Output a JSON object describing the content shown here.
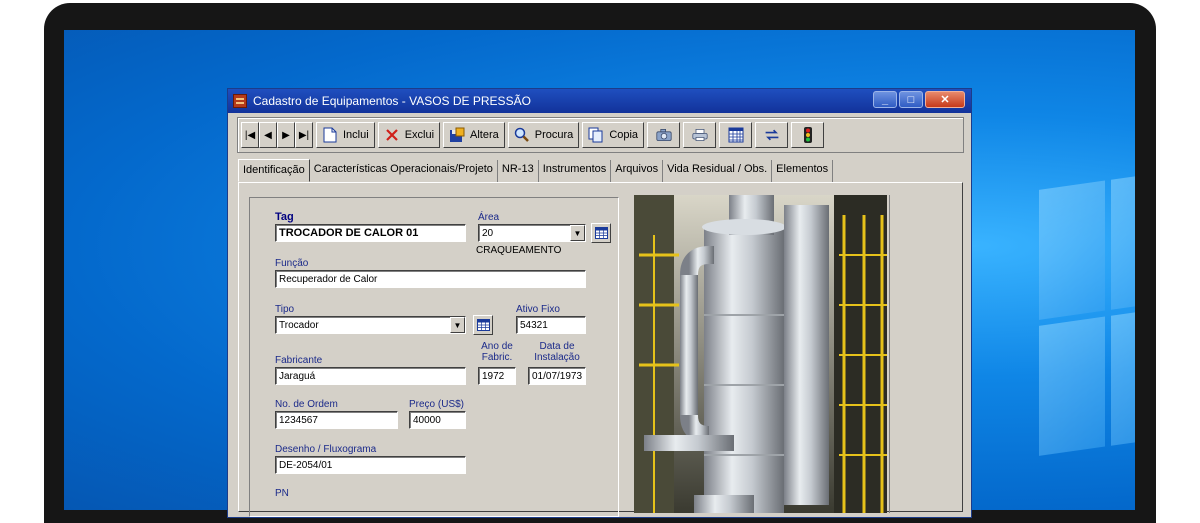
{
  "window": {
    "title": "Cadastro de Equipamentos - VASOS DE PRESSÃO",
    "minimize": "_",
    "maximize": "□",
    "close": "✕"
  },
  "toolbar": {
    "nav": {
      "first": "|◀",
      "prev": "◀",
      "next": "▶",
      "last": "▶|"
    },
    "inclui": "Inclui",
    "exclui": "Exclui",
    "altera": "Altera",
    "procura": "Procura",
    "copia": "Copia"
  },
  "tabs": [
    "Identificação",
    "Características Operacionais/Projeto",
    "NR-13",
    "Instrumentos",
    "Arquivos",
    "Vida Residual / Obs.",
    "Elementos"
  ],
  "form": {
    "tag_label": "Tag",
    "tag_value": "TROCADOR DE CALOR 01",
    "area_label": "Área",
    "area_value": "20",
    "area_desc": "CRAQUEAMENTO",
    "funcao_label": "Função",
    "funcao_value": "Recuperador de Calor",
    "tipo_label": "Tipo",
    "tipo_value": "Trocador",
    "ativo_label": "Ativo Fixo",
    "ativo_value": "54321",
    "fabricante_label": "Fabricante",
    "fabricante_value": "Jaraguá",
    "ano_label_1": "Ano de",
    "ano_label_2": "Fabric.",
    "ano_value": "1972",
    "data_label_1": "Data de",
    "data_label_2": "Instalação",
    "data_value": "01/07/1973",
    "ordem_label": "No. de Ordem",
    "ordem_value": "1234567",
    "preco_label": "Preço (US$)",
    "preco_value": "40000",
    "desenho_label": "Desenho / Fluxograma",
    "desenho_value": "DE-2054/01",
    "pn_label": "PN"
  },
  "colors": {
    "titlebar": "#1f4fbf",
    "label": "#1b2a8a",
    "desktop": "#0f86e6"
  }
}
